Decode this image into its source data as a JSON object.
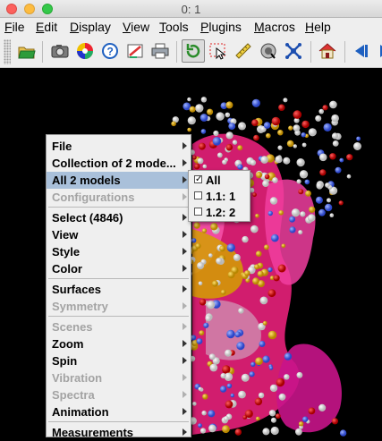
{
  "window": {
    "title": "0: 1"
  },
  "menubar": {
    "items": [
      "File",
      "Edit",
      "Display",
      "View",
      "Tools",
      "Plugins",
      "Macros",
      "Help"
    ]
  },
  "toolbar": {
    "buttons": [
      "open-icon",
      "camera-icon",
      "color-wheel-icon",
      "help-icon",
      "edit-icon",
      "print-icon",
      "rotate-icon",
      "select-icon",
      "ruler-icon",
      "navigate-icon",
      "pick-icon",
      "home-icon",
      "back-icon",
      "forward-icon"
    ],
    "active": [
      "rotate-icon"
    ]
  },
  "popup_menu": {
    "items": [
      {
        "label": "File",
        "enabled": true,
        "submenu": true
      },
      {
        "label": "Collection of 2 mode...",
        "enabled": true,
        "submenu": true
      },
      {
        "label": "All 2 models",
        "enabled": true,
        "submenu": true,
        "selected": true
      },
      {
        "label": "Configurations",
        "enabled": false,
        "submenu": true
      },
      {
        "label": "Select (4846)",
        "enabled": true,
        "submenu": true
      },
      {
        "label": "View",
        "enabled": true,
        "submenu": true
      },
      {
        "label": "Style",
        "enabled": true,
        "submenu": true
      },
      {
        "label": "Color",
        "enabled": true,
        "submenu": true
      },
      {
        "label": "Surfaces",
        "enabled": true,
        "submenu": true
      },
      {
        "label": "Symmetry",
        "enabled": false,
        "submenu": true
      },
      {
        "label": "Scenes",
        "enabled": false,
        "submenu": true
      },
      {
        "label": "Zoom",
        "enabled": true,
        "submenu": true
      },
      {
        "label": "Spin",
        "enabled": true,
        "submenu": true
      },
      {
        "label": "Vibration",
        "enabled": false,
        "submenu": true
      },
      {
        "label": "Spectra",
        "enabled": false,
        "submenu": true
      },
      {
        "label": "Animation",
        "enabled": true,
        "submenu": true
      },
      {
        "label": "Measurements",
        "enabled": true,
        "submenu": true
      }
    ]
  },
  "submenu": {
    "items": [
      {
        "label": "All",
        "checked": true
      },
      {
        "label": "1.1: 1",
        "checked": false
      },
      {
        "label": "1.2: 2",
        "checked": false
      }
    ]
  },
  "colors": {
    "menu_highlight": "#a9c0da",
    "viewer_bg": "#000000"
  }
}
